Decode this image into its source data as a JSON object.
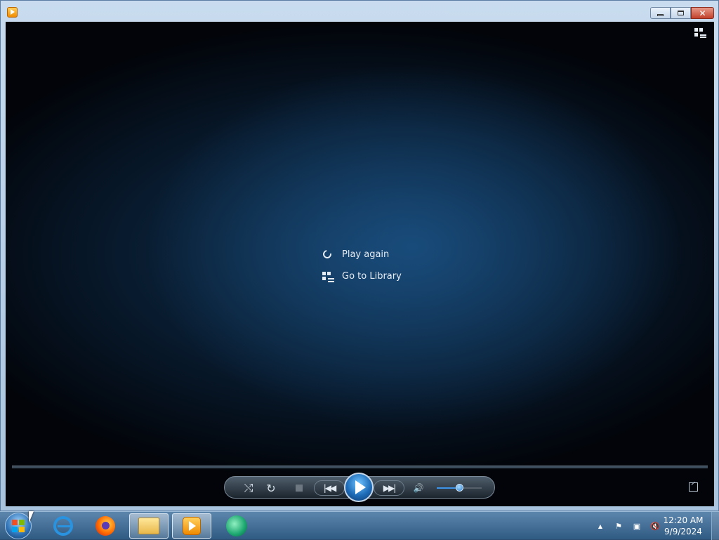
{
  "window": {
    "app_icon": "windows-media-player-icon",
    "caption_buttons": {
      "minimize": "minimize-icon",
      "maximize": "maximize-icon",
      "close_label": "✕"
    }
  },
  "player": {
    "switch_to_library_icon": "switch-to-library-icon",
    "menu": [
      {
        "label": "Play again",
        "icon": "replay-icon"
      },
      {
        "label": "Go to Library",
        "icon": "library-icon"
      }
    ],
    "controls": {
      "shuffle_icon": "⤭",
      "repeat_icon": "↻",
      "stop_icon": "stop-icon",
      "previous_label": "|◀◀",
      "play_icon": "play-icon",
      "next_label": "▶▶|",
      "mute_icon": "🔊",
      "volume_level": 0.5,
      "fullscreen_icon": "fullscreen-icon"
    }
  },
  "taskbar": {
    "start_icon": "windows-start-orb",
    "items": [
      {
        "name": "internet-explorer",
        "icon": "ie-icon",
        "active": false
      },
      {
        "name": "firefox",
        "icon": "firefox-icon",
        "active": false
      },
      {
        "name": "file-explorer",
        "icon": "folder-icon",
        "active": true
      },
      {
        "name": "windows-media-player",
        "icon": "wmp-icon",
        "active": true
      },
      {
        "name": "green-app",
        "icon": "green-app-icon",
        "active": false
      }
    ],
    "tray": {
      "overflow": "▲",
      "flag": "⚑",
      "network": "▣",
      "volume": "🔇"
    },
    "clock": {
      "time": "12:20 AM",
      "date": "9/9/2024"
    }
  },
  "colors": {
    "taskbar": "#3a668f",
    "stage_glow": "#1c568c",
    "play_button": "#1e6cb8",
    "volume_fill": "#3e95e8"
  }
}
